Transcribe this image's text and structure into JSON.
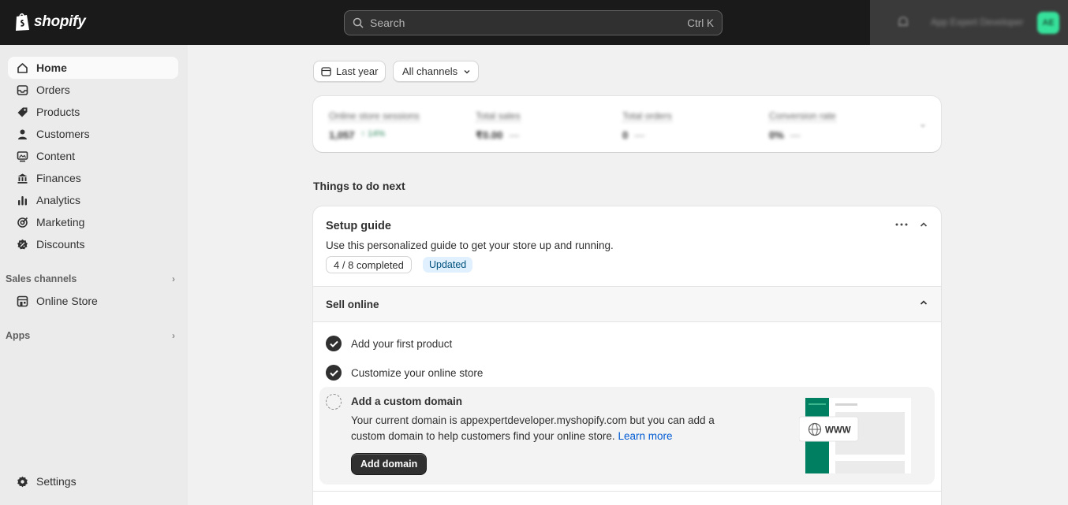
{
  "topbar": {
    "brand": "shopify",
    "search_placeholder": "Search",
    "search_shortcut": "Ctrl K",
    "account_name": "App Expert Developer",
    "avatar_initials": "AE"
  },
  "sidebar": {
    "items": [
      {
        "label": "Home",
        "icon": "home-icon"
      },
      {
        "label": "Orders",
        "icon": "inbox-icon"
      },
      {
        "label": "Products",
        "icon": "tag-icon"
      },
      {
        "label": "Customers",
        "icon": "person-icon"
      },
      {
        "label": "Content",
        "icon": "image-icon"
      },
      {
        "label": "Finances",
        "icon": "bank-icon"
      },
      {
        "label": "Analytics",
        "icon": "bar-chart-icon"
      },
      {
        "label": "Marketing",
        "icon": "target-icon"
      },
      {
        "label": "Discounts",
        "icon": "discount-icon"
      }
    ],
    "sales_channels": "Sales channels",
    "online_store": "Online Store",
    "apps": "Apps",
    "settings": "Settings"
  },
  "filters": {
    "date": "Last year",
    "channels": "All channels"
  },
  "metrics": [
    {
      "label": "Online store sessions",
      "value": "1,057",
      "change": "↑ 14%"
    },
    {
      "label": "Total sales",
      "value": "₹0.00",
      "change": "—"
    },
    {
      "label": "Total orders",
      "value": "0",
      "change": "—"
    },
    {
      "label": "Conversion rate",
      "value": "0%",
      "change": "—"
    }
  ],
  "things_heading": "Things to do next",
  "setup_guide": {
    "title": "Setup guide",
    "subtitle": "Use this personalized guide to get your store up and running.",
    "progress": "4 / 8 completed",
    "badge": "Updated",
    "section": "Sell online",
    "tasks": [
      {
        "label": "Add your first product",
        "done": true
      },
      {
        "label": "Customize your online store",
        "done": true
      }
    ],
    "active_task": {
      "title": "Add a custom domain",
      "desc": "Your current domain is appexpertdeveloper.myshopify.com but you can add a custom domain to help customers find your online store.",
      "link": "Learn more",
      "button": "Add domain",
      "illustration_text": "WWW"
    }
  },
  "colors": {
    "topbar": "#1a1a1a",
    "sidebar": "#ebebeb",
    "accent_green": "#008060",
    "link": "#005bd3"
  }
}
